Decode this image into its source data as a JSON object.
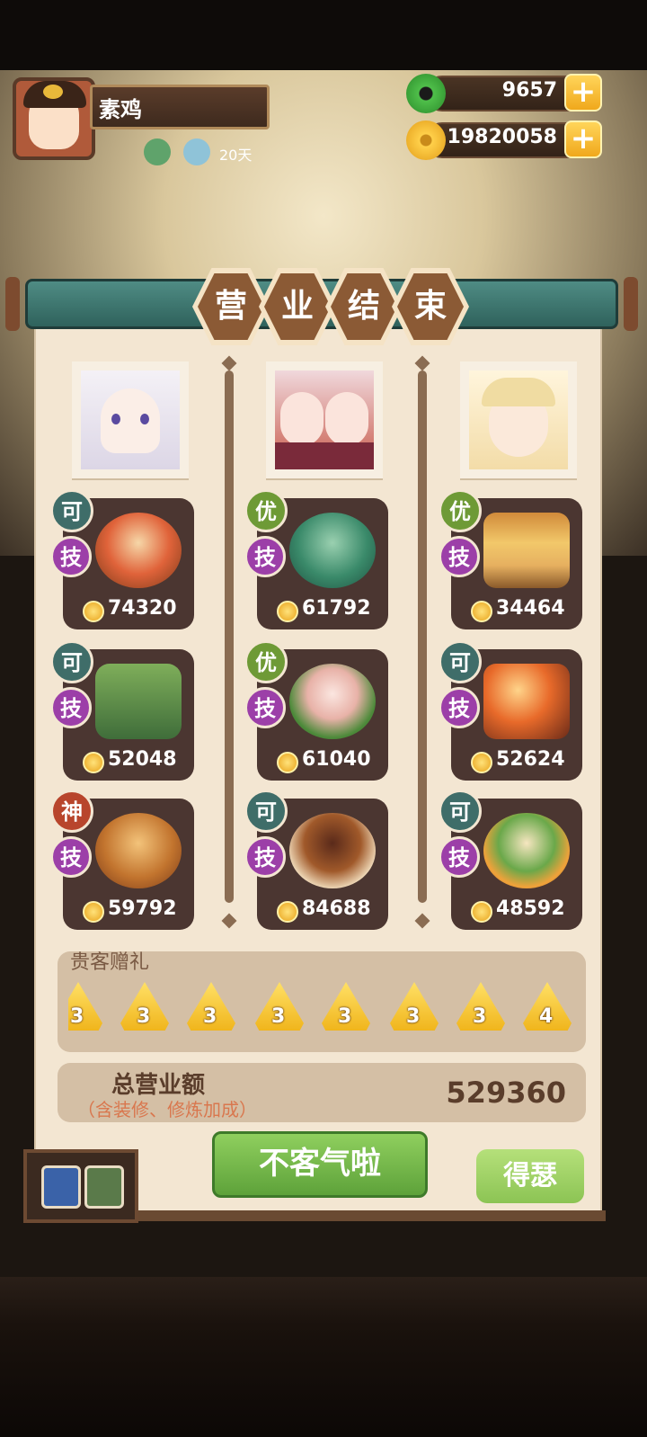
{
  "header": {
    "player_name": "素鸡",
    "days": "20天",
    "jade": "9657",
    "coins": "19820058",
    "plus_symbol": "+"
  },
  "title_chars": [
    "营",
    "业",
    "结",
    "束"
  ],
  "columns": [
    {
      "portrait": "character-white-hood",
      "dishes": [
        {
          "grade": "可",
          "grade_color": "#3f6d69",
          "skill": "技",
          "price": "74320"
        },
        {
          "grade": "可",
          "grade_color": "#3f6d69",
          "skill": "技",
          "price": "52048"
        },
        {
          "grade": "神",
          "grade_color": "#b8452c",
          "skill": "技",
          "price": "59792"
        }
      ]
    },
    {
      "portrait": "character-twins",
      "dishes": [
        {
          "grade": "优",
          "grade_color": "#6e9a36",
          "skill": "技",
          "price": "61792"
        },
        {
          "grade": "优",
          "grade_color": "#6e9a36",
          "skill": "技",
          "price": "61040"
        },
        {
          "grade": "可",
          "grade_color": "#3f6d69",
          "skill": "技",
          "price": "84688"
        }
      ]
    },
    {
      "portrait": "character-blonde",
      "dishes": [
        {
          "grade": "优",
          "grade_color": "#6e9a36",
          "skill": "技",
          "price": "34464"
        },
        {
          "grade": "可",
          "grade_color": "#3f6d69",
          "skill": "技",
          "price": "52624"
        },
        {
          "grade": "可",
          "grade_color": "#3f6d69",
          "skill": "技",
          "price": "48592"
        }
      ]
    }
  ],
  "gifts": {
    "title": "贵客赠礼",
    "counts": [
      "3",
      "3",
      "3",
      "3",
      "3",
      "3",
      "3",
      "4"
    ]
  },
  "revenue": {
    "label": "总营业额",
    "note": "（含装修、修炼加成）",
    "value": "529360"
  },
  "buttons": {
    "main": "不客气啦",
    "alt": "得瑟"
  },
  "colors": {
    "panel_bg": "#f3e6d2",
    "card_bg": "#4b3631",
    "skill_badge": "#9c3fa8",
    "green_button": "#6fb547"
  }
}
